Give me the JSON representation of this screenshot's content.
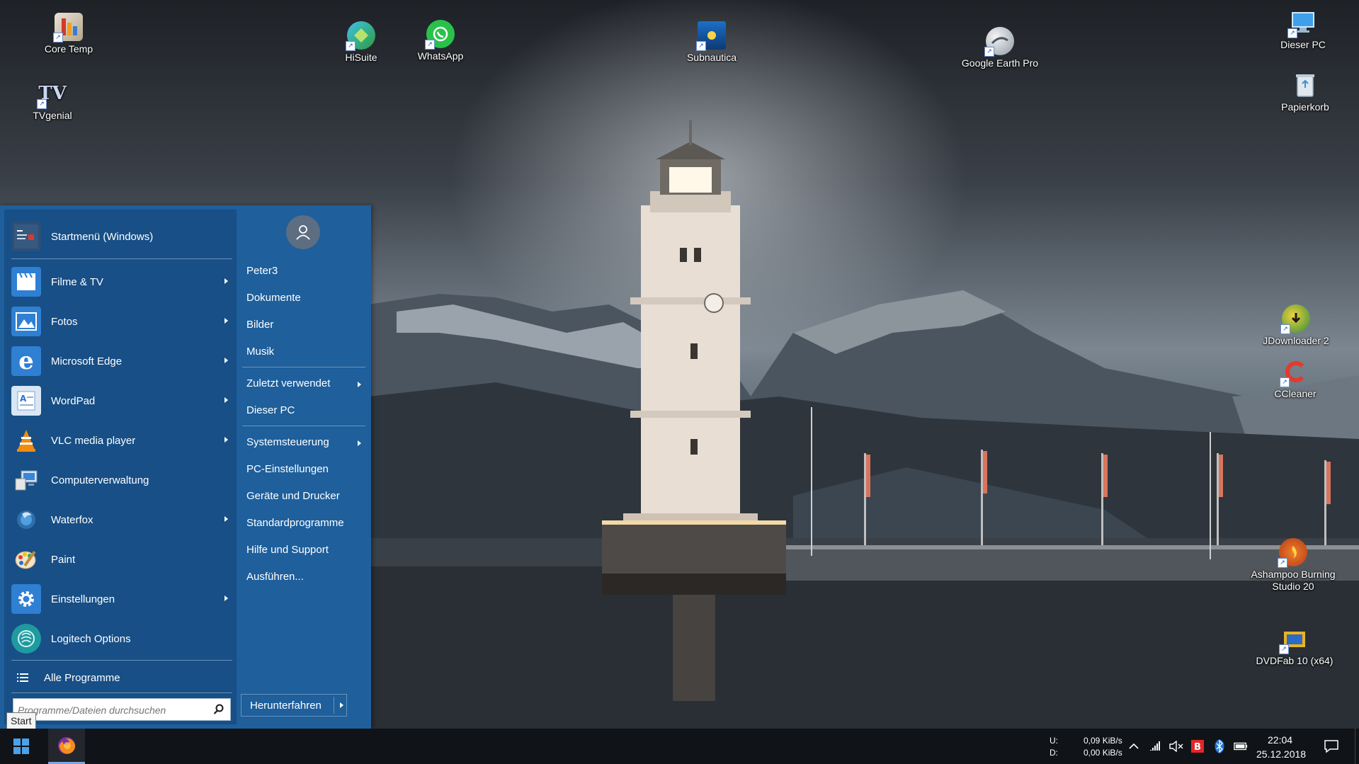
{
  "desktop": {
    "icons": [
      {
        "label": "Core Temp",
        "icon": "core-temp-icon"
      },
      {
        "label": "TVgenial",
        "icon": "tvgenial-icon"
      },
      {
        "label": "HiSuite",
        "icon": "hisuite-icon"
      },
      {
        "label": "WhatsApp",
        "icon": "whatsapp-icon"
      },
      {
        "label": "Subnautica",
        "icon": "subnautica-icon"
      },
      {
        "label": "Google Earth Pro",
        "icon": "google-earth-icon"
      },
      {
        "label": "Dieser PC",
        "icon": "computer-icon"
      },
      {
        "label": "Papierkorb",
        "icon": "recycle-bin-icon"
      },
      {
        "label": "JDownloader 2",
        "icon": "jdownloader-icon"
      },
      {
        "label": "CCleaner",
        "icon": "ccleaner-icon"
      },
      {
        "label": "Ashampoo Burning Studio 20",
        "icon": "ashampoo-icon"
      },
      {
        "label": "DVDFab 10 (x64)",
        "icon": "dvdfab-icon"
      }
    ]
  },
  "start_menu": {
    "apps": [
      {
        "label": "Startmenü (Windows)",
        "icon": "start-menu-icon",
        "submenu": false,
        "color": "#2b4f78"
      },
      {
        "label": "Filme & TV",
        "icon": "film-tv-icon",
        "submenu": true,
        "color": "#2f7fd3"
      },
      {
        "label": "Fotos",
        "icon": "photos-icon",
        "submenu": true,
        "color": "#2f7fd3"
      },
      {
        "label": "Microsoft Edge",
        "icon": "edge-icon",
        "submenu": true,
        "color": "#2f7fd3"
      },
      {
        "label": "WordPad",
        "icon": "wordpad-icon",
        "submenu": true,
        "color": "#d8e6f5"
      },
      {
        "label": "VLC media player",
        "icon": "vlc-icon",
        "submenu": true,
        "color": "#174f86"
      },
      {
        "label": "Computerverwaltung",
        "icon": "computer-management-icon",
        "submenu": false,
        "color": "#174f86"
      },
      {
        "label": "Waterfox",
        "icon": "waterfox-icon",
        "submenu": true,
        "color": "#174f86"
      },
      {
        "label": "Paint",
        "icon": "paint-icon",
        "submenu": false,
        "color": "#174f86"
      },
      {
        "label": "Einstellungen",
        "icon": "settings-gear-icon",
        "submenu": true,
        "color": "#2f7fd3"
      },
      {
        "label": "Logitech Options",
        "icon": "logitech-icon",
        "submenu": false,
        "color": "#1f9aa0"
      }
    ],
    "all_programs": "Alle Programme",
    "search_placeholder": "Programme/Dateien durchsuchen",
    "user_links": [
      {
        "label": "Peter3",
        "submenu": false
      },
      {
        "label": "Dokumente",
        "submenu": false
      },
      {
        "label": "Bilder",
        "submenu": false
      },
      {
        "label": "Musik",
        "submenu": false
      }
    ],
    "recent_links": [
      {
        "label": "Zuletzt verwendet",
        "submenu": true
      },
      {
        "label": "Dieser PC",
        "submenu": false
      }
    ],
    "system_links": [
      {
        "label": "Systemsteuerung",
        "submenu": true
      },
      {
        "label": "PC-Einstellungen",
        "submenu": false
      },
      {
        "label": "Geräte und Drucker",
        "submenu": false
      },
      {
        "label": "Standardprogramme",
        "submenu": false
      },
      {
        "label": "Hilfe und Support",
        "submenu": false
      },
      {
        "label": "Ausführen...",
        "submenu": false
      }
    ],
    "shutdown_label": "Herunterfahren",
    "tooltip": "Start"
  },
  "taskbar": {
    "net_upload_label": "U:",
    "net_download_label": "D:",
    "net_upload_value": "0,09 KiB/s",
    "net_download_value": "0,00 KiB/s",
    "time": "22:04",
    "date": "25.12.2018"
  }
}
